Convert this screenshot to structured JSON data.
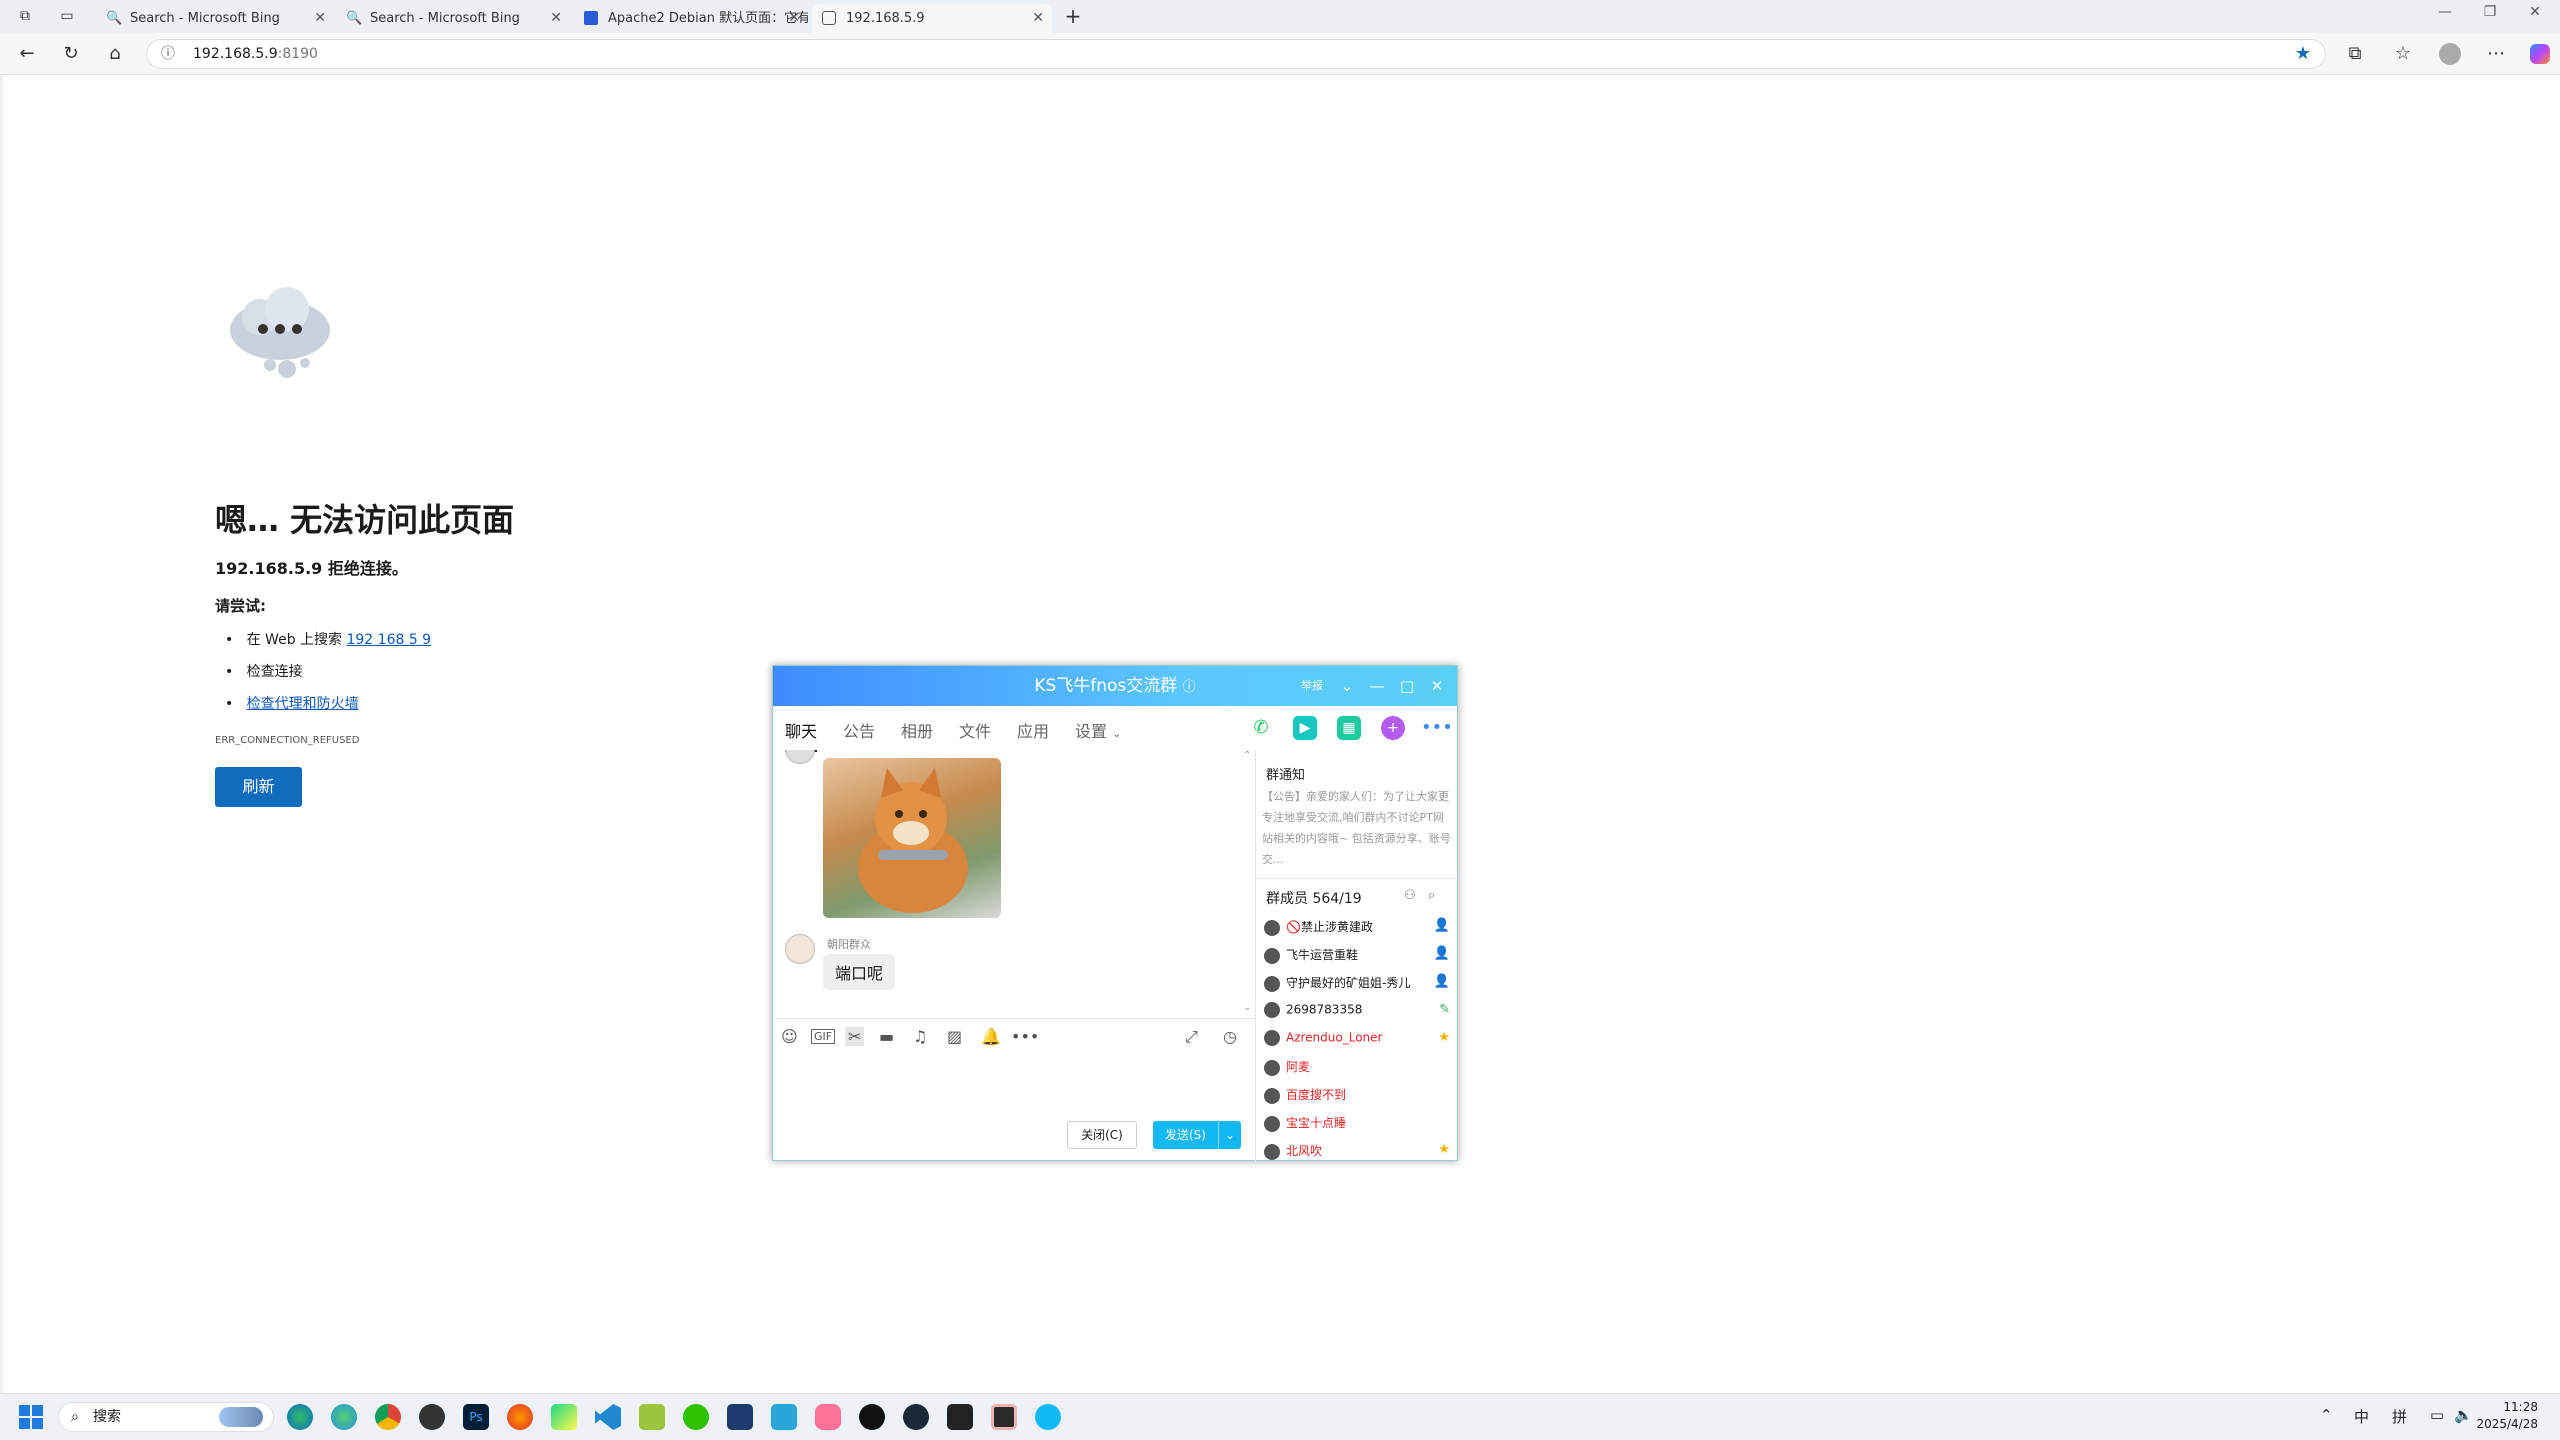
{
  "browser": {
    "tabs": [
      {
        "label": "Search - Microsoft Bing",
        "active": false
      },
      {
        "label": "Search - Microsoft Bing",
        "active": false
      },
      {
        "label": "Apache2 Debian 默认页面：它有",
        "active": false
      },
      {
        "label": "192.168.5.9",
        "active": true
      }
    ],
    "url_host": "192.168.5.9",
    "url_port": ":8190"
  },
  "error_page": {
    "title": "嗯… 无法访问此页面",
    "subtitle": "192.168.5.9 拒绝连接。",
    "try_heading": "请尝试:",
    "try_item1_prefix": "在 Web 上搜索 ",
    "try_item1_link": "192 168 5 9",
    "try_item2": "检查连接",
    "try_item3": "检查代理和防火墙",
    "error_code": "ERR_CONNECTION_REFUSED",
    "refresh_label": "刷新"
  },
  "qq": {
    "title": "KS飞牛fnos交流群",
    "report_label": "举报",
    "tabs": [
      "聊天",
      "公告",
      "相册",
      "文件",
      "应用",
      "设置"
    ],
    "sender": "朝阳群众",
    "message": "端口呢",
    "close_label": "关闭(C)",
    "send_label": "发送(S)",
    "notice_heading": "群通知",
    "notice_text": "【公告】亲爱的家人们：为了让大家更专注地享受交流,咱们群内不讨论PT网站相关的内容哦~ 包括资源分享、账号交...",
    "members_heading": "群成员 564/19",
    "members": [
      {
        "name": "🚫禁止涉黄建政",
        "red": false,
        "badge": "👤"
      },
      {
        "name": "飞牛运营重鞋",
        "red": false,
        "badge": "👤"
      },
      {
        "name": "守护最好的矿姐姐-秀儿",
        "red": false,
        "badge": "👤"
      },
      {
        "name": "2698783358",
        "red": false,
        "badge": "✎"
      },
      {
        "name": "Azrenduo_Loner",
        "red": true,
        "badge": "★"
      },
      {
        "name": "阿麦",
        "red": true,
        "badge": ""
      },
      {
        "name": "百度搜不到",
        "red": true,
        "badge": ""
      },
      {
        "name": "宝宝十点睡",
        "red": true,
        "badge": ""
      },
      {
        "name": "北风吹",
        "red": true,
        "badge": "★"
      }
    ]
  },
  "taskbar": {
    "search_placeholder": "搜索",
    "ime_lang": "中",
    "ime_mode": "拼",
    "time": "11:28",
    "date": "2025/4/28"
  },
  "colors": {
    "accent": "#0f6cbd",
    "qq_send": "#12b7f5",
    "link": "#0b57b7"
  }
}
